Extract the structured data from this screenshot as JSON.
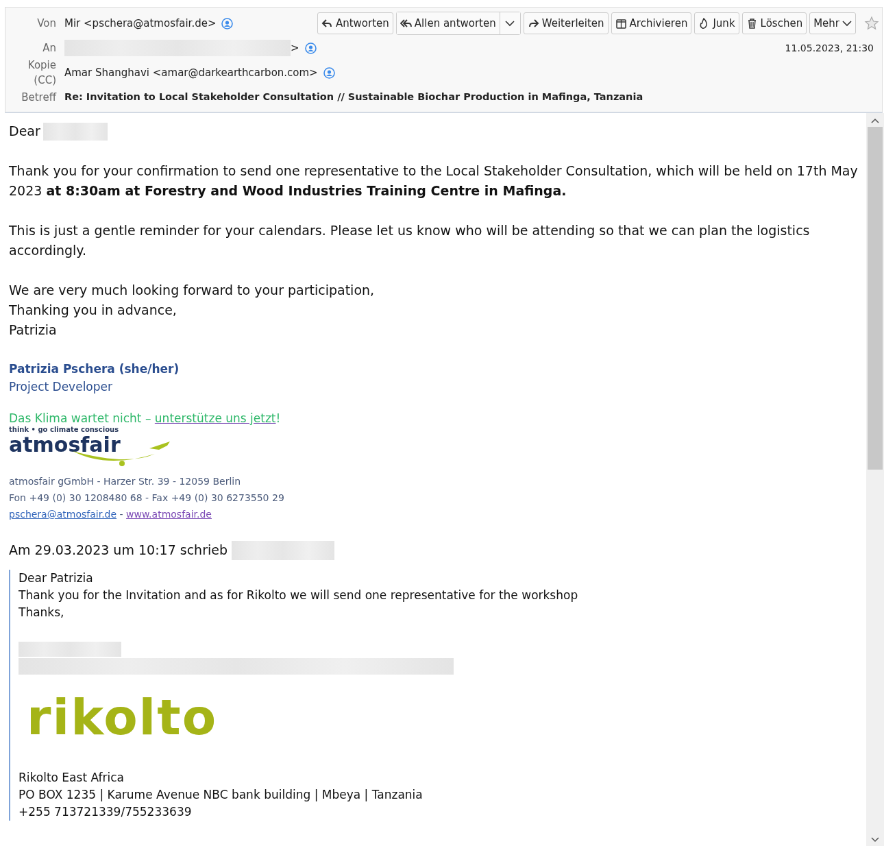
{
  "header": {
    "from": {
      "label": "Von",
      "value": "Mir <pschera@atmosfair.de>"
    },
    "to": {
      "label": "An",
      "value": ">"
    },
    "cc": {
      "label": "Kopie (CC)",
      "value": "Amar Shanghavi <amar@darkearthcarbon.com>"
    },
    "subject": {
      "label": "Betreff",
      "value": "Re: Invitation to Local Stakeholder Consultation // Sustainable Biochar Production in Mafinga, Tanzania"
    },
    "date": "11.05.2023, 21:30",
    "buttons": [
      {
        "kind": "reply",
        "label": "Antworten"
      },
      {
        "kind": "reply-all",
        "label": "Allen antworten"
      },
      {
        "kind": "forward",
        "label": "Weiterleiten"
      },
      {
        "kind": "archive",
        "label": "Archivieren"
      },
      {
        "kind": "junk",
        "label": "Junk"
      },
      {
        "kind": "delete",
        "label": "Löschen"
      },
      {
        "kind": "more",
        "label": "Mehr"
      }
    ],
    "starred": false
  },
  "body": {
    "greeting": "Dear",
    "paragraphs": [
      "Thank you for your confirmation to send one representative to the Local Stakeholder Consultation, which will be held on 17th May 2023 **at 8:30am at Forestry and Wood Industries Training Centre in Mafinga.**",
      "This is just a gentle reminder for your calendars. Please let us know who will be attending so that we can plan the logistics accordingly."
    ],
    "closing": [
      "We are very much looking forward to your participation,",
      "Thanking you in advance,",
      "Patrizia"
    ],
    "signature": {
      "name": "Patrizia Pschera (she/her)",
      "role": "Project Developer",
      "slogan": "Das Klima wartet nicht – ",
      "slogan_link": "unterstütze uns jetzt",
      "slogan_end": "!",
      "tagline": "think • go climate conscious",
      "logo": "atmosfair",
      "address": "atmosfair gGmbH - Harzer Str. 39 - 12059 Berlin",
      "phone": "Fon +49 (0) 30 1208480 68 - Fax +49 (0) 30 6273550 29",
      "email": "pschera@atmosfair.de",
      "separator": " - ",
      "website": "www.atmosfair.de"
    },
    "quote_intro": "Am 29.03.2023 um 10:17 schrieb",
    "quote": {
      "lines": [
        "Dear Patrizia",
        "Thank you for the Invitation  and as for Rikolto we will send one representative for the workshop",
        "Thanks,"
      ],
      "logo": "rikolto",
      "address": [
        "Rikolto East Africa",
        "PO BOX 1235 | Karume Avenue NBC bank building | Mbeya | Tanzania",
        "+255  713721339/755233639"
      ]
    }
  }
}
